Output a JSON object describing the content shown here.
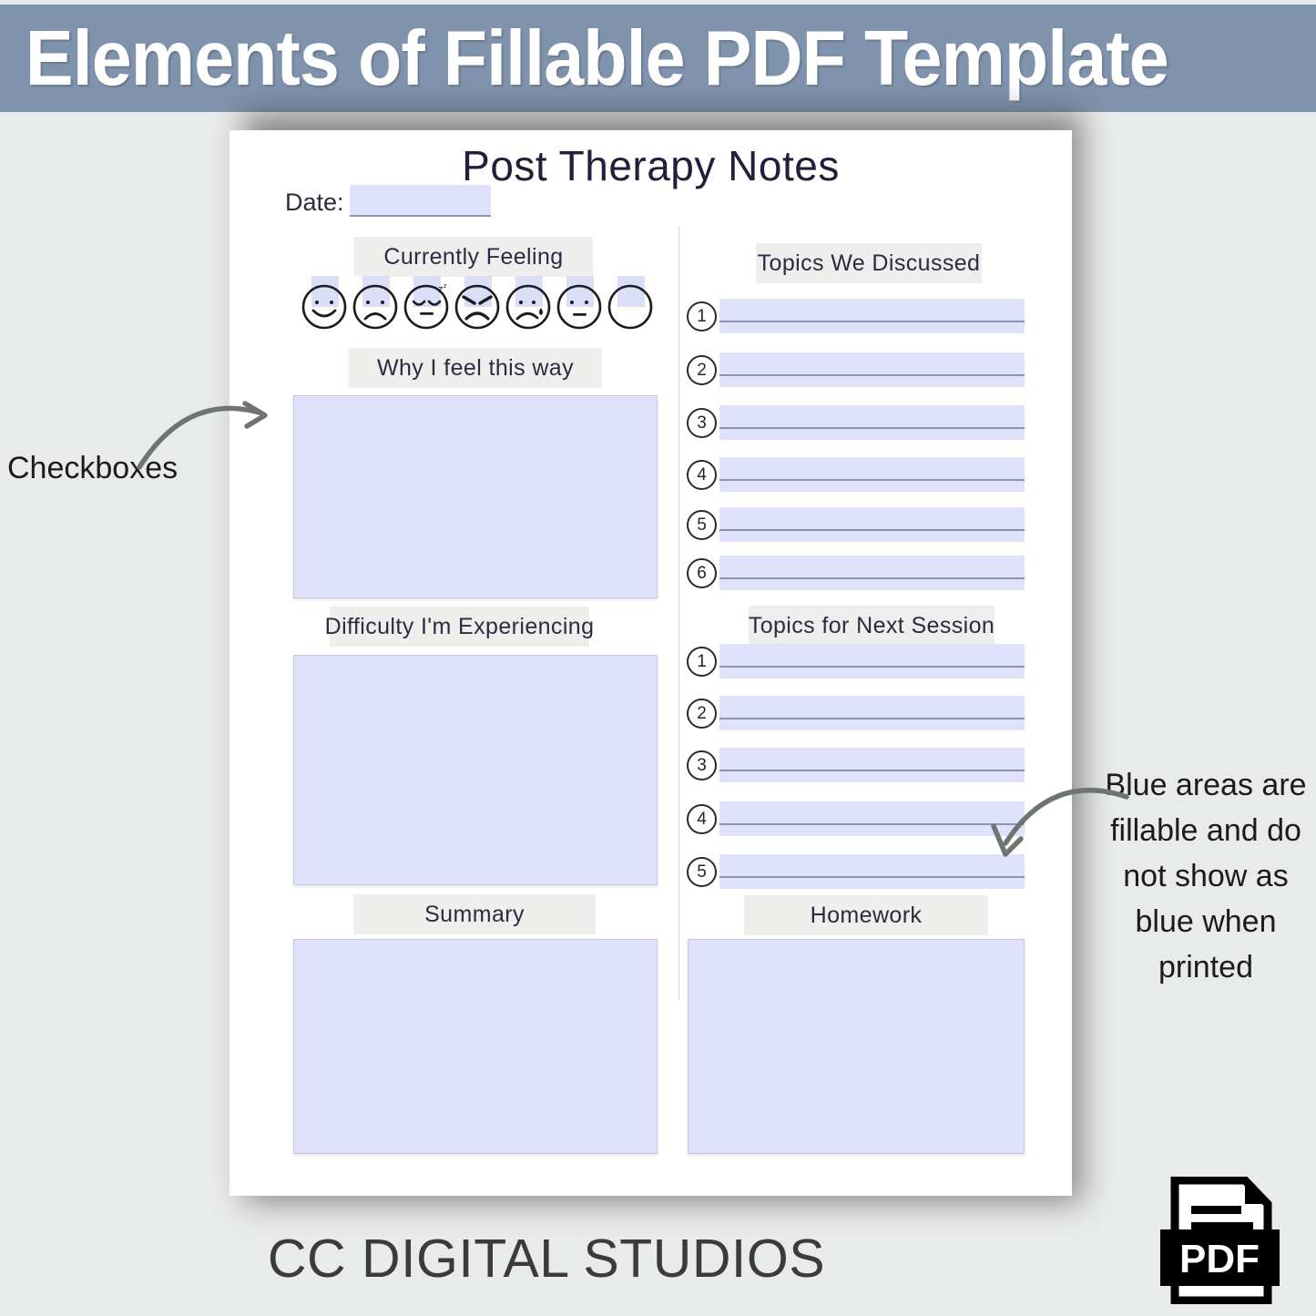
{
  "banner": {
    "title": "Elements of Fillable PDF Template",
    "bg_color": "#8093ad",
    "text_color": "#ffffff"
  },
  "document": {
    "title": "Post Therapy Notes",
    "date": {
      "label": "Date:",
      "value": "",
      "placeholder": ""
    },
    "fill_color": "#dfe2fa",
    "chip_color": "#eeeeec",
    "left_column": {
      "currently_feeling": {
        "label": "Currently Feeling",
        "options": [
          {
            "name": "happy-face",
            "checked": false
          },
          {
            "name": "sad-face",
            "checked": false
          },
          {
            "name": "sleepy-face",
            "checked": false
          },
          {
            "name": "angry-face",
            "checked": false
          },
          {
            "name": "crying-face",
            "checked": false
          },
          {
            "name": "neutral-face",
            "checked": false
          },
          {
            "name": "blank-face",
            "checked": false
          }
        ]
      },
      "why_i_feel": {
        "label": "Why I feel this way",
        "value": ""
      },
      "difficulty": {
        "label": "Difficulty I'm Experiencing",
        "value": ""
      },
      "summary": {
        "label": "Summary",
        "value": ""
      }
    },
    "right_column": {
      "topics_discussed": {
        "label": "Topics We Discussed",
        "items": [
          {
            "number": "1",
            "value": ""
          },
          {
            "number": "2",
            "value": ""
          },
          {
            "number": "3",
            "value": ""
          },
          {
            "number": "4",
            "value": ""
          },
          {
            "number": "5",
            "value": ""
          },
          {
            "number": "6",
            "value": ""
          }
        ]
      },
      "topics_next": {
        "label": "Topics for Next Session",
        "items": [
          {
            "number": "1",
            "value": ""
          },
          {
            "number": "2",
            "value": ""
          },
          {
            "number": "3",
            "value": ""
          },
          {
            "number": "4",
            "value": ""
          },
          {
            "number": "5",
            "value": ""
          }
        ]
      },
      "homework": {
        "label": "Homework",
        "value": ""
      }
    }
  },
  "annotations": {
    "left": "Checkboxes",
    "right": "Blue areas are fillable and do not show as blue when printed",
    "arrow_color": "#6e7472"
  },
  "footer": {
    "brand": "CC DIGITAL STUDIOS",
    "badge": "PDF"
  }
}
